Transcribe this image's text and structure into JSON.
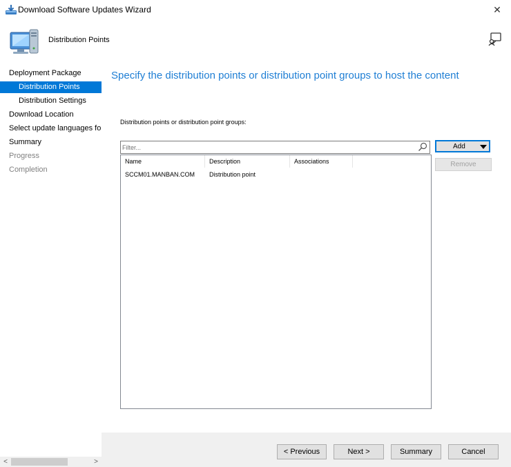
{
  "window": {
    "title": "Download Software Updates Wizard",
    "close_glyph": "✕",
    "title_icon": "download-icon",
    "accent_color": "#0078d7",
    "heading_color": "#1e7ed4"
  },
  "header": {
    "title": "Distribution Points",
    "icon": "computer-icon",
    "feedback_icon": "feedback-icon"
  },
  "nav": {
    "items": [
      {
        "label": "Deployment Package",
        "level": 0,
        "state": "normal"
      },
      {
        "label": "Distribution Points",
        "level": 1,
        "state": "selected"
      },
      {
        "label": "Distribution Settings",
        "level": 1,
        "state": "normal"
      },
      {
        "label": "Download Location",
        "level": 0,
        "state": "normal"
      },
      {
        "label": "Select update languages for",
        "level": 0,
        "state": "normal"
      },
      {
        "label": "Summary",
        "level": 0,
        "state": "normal"
      },
      {
        "label": "Progress",
        "level": 0,
        "state": "disabled"
      },
      {
        "label": "Completion",
        "level": 0,
        "state": "disabled"
      }
    ],
    "scroll_left": "<",
    "scroll_right": ">"
  },
  "main": {
    "heading": "Specify the distribution points or distribution point groups to host the content",
    "list_label": "Distribution points or distribution point groups:",
    "filter_placeholder": "Filter...",
    "columns": [
      "Name",
      "Description",
      "Associations"
    ],
    "rows": [
      {
        "name": "SCCM01.MANBAN.COM",
        "description": "Distribution point",
        "associations": ""
      }
    ],
    "add_label": "Add",
    "remove_label": "Remove"
  },
  "footer": {
    "previous": "< Previous",
    "next": "Next >",
    "summary": "Summary",
    "cancel": "Cancel"
  }
}
